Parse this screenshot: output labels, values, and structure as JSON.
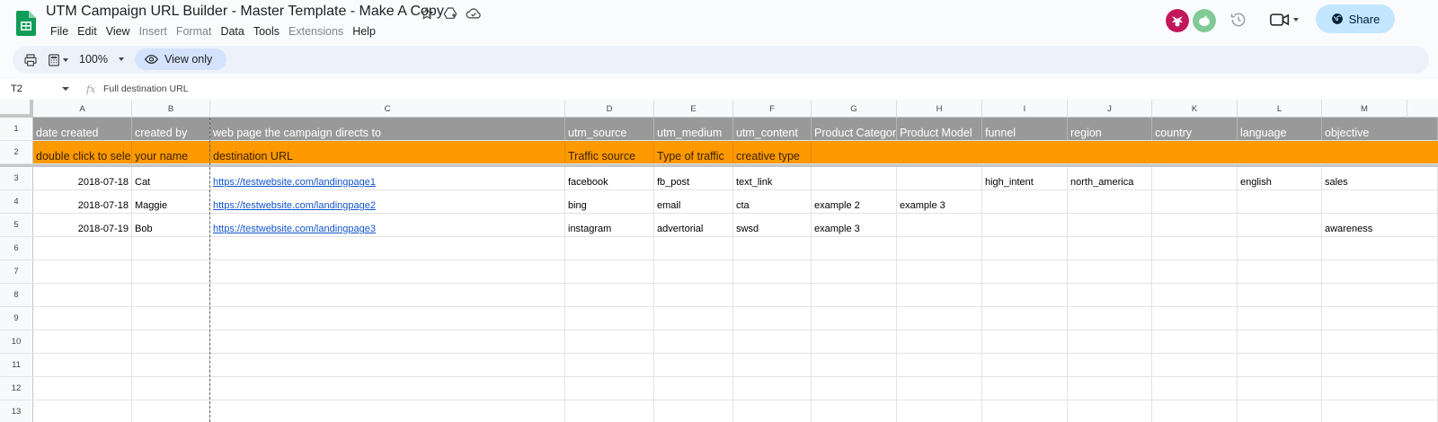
{
  "app": {
    "title": "UTM Campaign URL Builder - Master Template - Make A Copy"
  },
  "menu": [
    "File",
    "Edit",
    "View",
    "Insert",
    "Format",
    "Data",
    "Tools",
    "Extensions",
    "Help"
  ],
  "menu_disabled": [
    "Insert",
    "Format",
    "Extensions"
  ],
  "share_label": "Share",
  "toolbar": {
    "zoom": "100%",
    "view_only": "View only"
  },
  "formula_bar": {
    "cell_ref": "T2",
    "fx": "fx",
    "value": "Full destination URL"
  },
  "columns": [
    "A",
    "B",
    "C",
    "D",
    "E",
    "F",
    "G",
    "H",
    "I",
    "J",
    "K",
    "L",
    "M"
  ],
  "rows": [
    {
      "n": "1",
      "cells": [
        "date created",
        "created by",
        "web page the campaign directs to",
        "utm_source",
        "utm_medium",
        "utm_content",
        "Product Category",
        "Product Model",
        "funnel",
        "region",
        "country",
        "language",
        "objective"
      ]
    },
    {
      "n": "2",
      "cells": [
        "double click to select",
        "your name",
        "destination URL",
        "Traffic source",
        "Type of traffic",
        "creative type",
        "",
        "",
        "",
        "",
        "",
        "",
        ""
      ]
    },
    {
      "n": "3",
      "cells": [
        "2018-07-18",
        "Cat",
        "https://testwebsite.com/landingpage1",
        "facebook",
        "fb_post",
        "text_link",
        "",
        "",
        "high_intent",
        "north_america",
        "",
        "english",
        "sales"
      ]
    },
    {
      "n": "4",
      "cells": [
        "2018-07-18",
        "Maggie",
        "https://testwebsite.com/landingpage2",
        "bing",
        "email",
        "cta",
        "example 2",
        "example 3",
        "",
        "",
        "",
        "",
        ""
      ]
    },
    {
      "n": "5",
      "cells": [
        "2018-07-19",
        "Bob",
        "https://testwebsite.com/landingpage3",
        "instagram",
        "advertorial",
        "swsd",
        "example 3",
        "",
        "",
        "",
        "",
        "",
        "awareness"
      ]
    },
    {
      "n": "6",
      "cells": []
    },
    {
      "n": "7",
      "cells": []
    },
    {
      "n": "8",
      "cells": []
    },
    {
      "n": "9",
      "cells": []
    },
    {
      "n": "10",
      "cells": []
    },
    {
      "n": "11",
      "cells": []
    },
    {
      "n": "12",
      "cells": []
    },
    {
      "n": "13",
      "cells": []
    }
  ],
  "colors": {
    "header_gray": "#999999",
    "instruction_orange": "#ff9900",
    "share_bg": "#c2e7ff",
    "link": "#1155cc",
    "sheets_green": "#0f9d58"
  }
}
